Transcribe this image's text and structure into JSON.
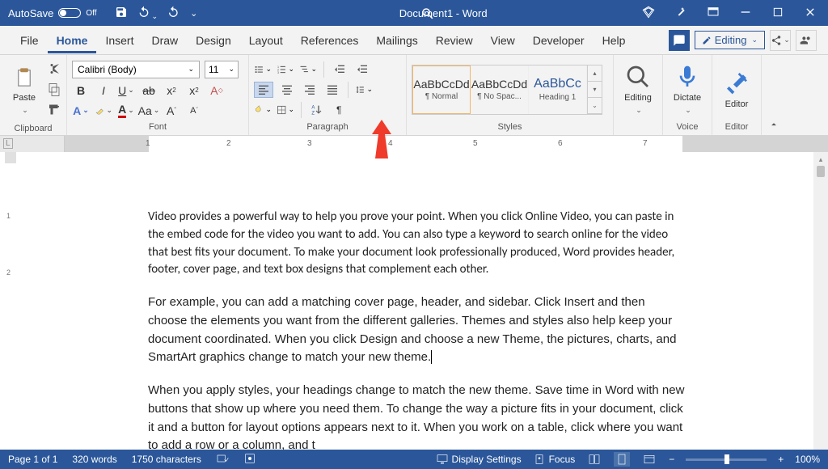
{
  "titleBar": {
    "autosave": "AutoSave",
    "autosaveState": "Off",
    "title": "Document1  -  Word"
  },
  "menu": {
    "file": "File",
    "home": "Home",
    "insert": "Insert",
    "draw": "Draw",
    "design": "Design",
    "layout": "Layout",
    "references": "References",
    "mailings": "Mailings",
    "review": "Review",
    "view": "View",
    "developer": "Developer",
    "help": "Help",
    "editing": "Editing"
  },
  "ribbon": {
    "clipboard": {
      "paste": "Paste",
      "label": "Clipboard"
    },
    "font": {
      "name": "Calibri (Body)",
      "size": "11",
      "label": "Font"
    },
    "paragraph": {
      "label": "Paragraph"
    },
    "styles": {
      "label": "Styles",
      "items": [
        {
          "preview": "AaBbCcDd",
          "name": "¶ Normal"
        },
        {
          "preview": "AaBbCcDd",
          "name": "¶ No Spac..."
        },
        {
          "preview": "AaBbC⁠c",
          "name": "Heading 1"
        }
      ]
    },
    "editing": {
      "label": "Editing"
    },
    "voice": {
      "dictate": "Dictate",
      "label": "Voice"
    },
    "editor": {
      "editor": "Editor",
      "label": "Editor"
    }
  },
  "ruler": {
    "marks": [
      "1",
      "2",
      "3",
      "4",
      "5",
      "6",
      "7"
    ]
  },
  "document": {
    "p1": "Video provides a powerful way to help you prove your point. When you click Online Video, you can paste in the embed code for the video you want to add. You can also type a keyword to search online for the video that best fits your document. To make your document look professionally produced, Word provides header, footer, cover page, and text box designs that complement each other.",
    "p2": "For example, you can add a matching cover page, header, and sidebar. Click Insert and then choose the elements you want from the different galleries. Themes and styles also help keep your document coordinated. When you click Design and choose a new Theme, the pictures, charts, and SmartArt graphics change to match your new theme.",
    "p3a": "When you apply styles, your headings change to match the new theme. Save time in Word with new buttons that show up where you need them. To change the way a picture fits in your document, click it and a button for layout options appears next to it. When you work on a table, click where you want to add a row or a column, and ",
    "p3b": "t"
  },
  "status": {
    "page": "Page 1 of 1",
    "words": "320 words",
    "chars": "1750 characters",
    "display": "Display Settings",
    "focus": "Focus",
    "zoom": "100%"
  }
}
